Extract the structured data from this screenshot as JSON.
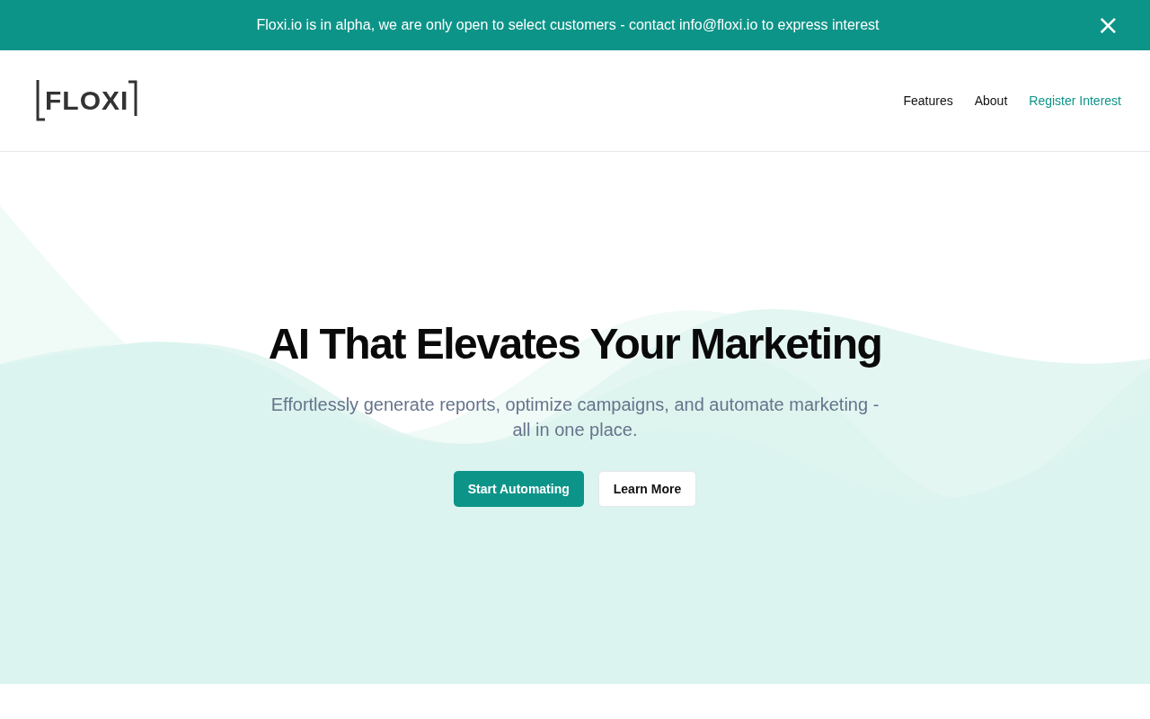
{
  "banner": {
    "text": "Floxi.io is in alpha, we are only open to select customers - contact info@floxi.io to express interest",
    "close": "×"
  },
  "header": {
    "logo": "FLOXI",
    "nav": [
      {
        "label": "Features",
        "kind": "plain"
      },
      {
        "label": "About",
        "kind": "plain"
      },
      {
        "label": "Register Interest",
        "kind": "accent"
      }
    ]
  },
  "hero": {
    "title": "AI That Elevates Your Marketing",
    "subtitle": "Effortlessly generate reports, optimize campaigns, and automate marketing - all in one place.",
    "buttons": [
      {
        "label": "Start Automating",
        "kind": "primary"
      },
      {
        "label": "Learn More",
        "kind": "secondary"
      }
    ]
  }
}
